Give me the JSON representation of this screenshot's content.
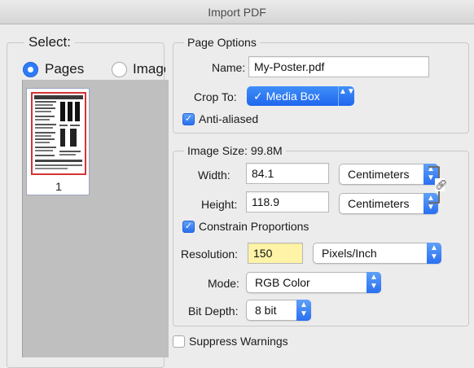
{
  "window": {
    "title": "Import PDF"
  },
  "select": {
    "title": "Select:",
    "options": [
      {
        "label": "Pages",
        "selected": true
      },
      {
        "label": "Images",
        "selected": false
      }
    ],
    "thumbnails": [
      {
        "page_number": "1"
      }
    ]
  },
  "page_options": {
    "title": "Page Options",
    "name_label": "Name:",
    "name_value": "My-Poster.pdf",
    "crop_label": "Crop To:",
    "crop_value": "✓ Media Box",
    "anti_aliased_label": "Anti-aliased",
    "anti_aliased_checked": true
  },
  "image_size": {
    "title": "Image Size: 99.8M",
    "width_label": "Width:",
    "width_value": "84.1",
    "width_unit": "Centimeters",
    "height_label": "Height:",
    "height_value": "118.9",
    "height_unit": "Centimeters",
    "constrain_label": "Constrain Proportions",
    "constrain_checked": true,
    "resolution_label": "Resolution:",
    "resolution_value": "150",
    "resolution_unit": "Pixels/Inch",
    "mode_label": "Mode:",
    "mode_value": "RGB Color",
    "bit_depth_label": "Bit Depth:",
    "bit_depth_value": "8 bit"
  },
  "suppress_warnings": {
    "label": "Suppress Warnings",
    "checked": false
  },
  "colors": {
    "accent": "#2e7cf6",
    "highlight": "#fff3a8",
    "thumbnail_border": "#d43434"
  }
}
